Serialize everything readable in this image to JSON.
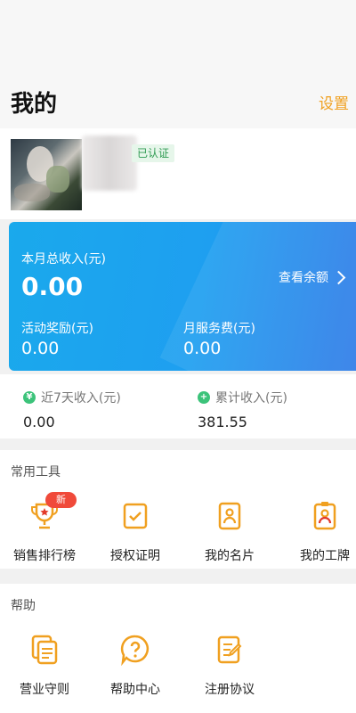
{
  "header": {
    "title": "我的",
    "settings_label": "设置"
  },
  "profile": {
    "verified_label": "已认证"
  },
  "income": {
    "month_total_label": "本月总收入(元)",
    "month_total_value": "0.00",
    "view_balance_label": "查看余额",
    "activity_reward_label": "活动奖励(元)",
    "activity_reward_value": "0.00",
    "monthly_fee_label": "月服务费(元)",
    "monthly_fee_value": "0.00"
  },
  "summary": {
    "last7_label": "近7天收入(元)",
    "last7_value": "0.00",
    "total_label": "累计收入(元)",
    "total_value": "381.55"
  },
  "tools": {
    "title": "常用工具",
    "new_badge": "新",
    "items": [
      {
        "label": "销售排行榜",
        "icon": "trophy-icon"
      },
      {
        "label": "授权证明",
        "icon": "certificate-icon"
      },
      {
        "label": "我的名片",
        "icon": "business-card-icon"
      },
      {
        "label": "我的工牌",
        "icon": "work-badge-icon"
      }
    ]
  },
  "help": {
    "title": "帮助",
    "items": [
      {
        "label": "营业守则",
        "icon": "documents-icon"
      },
      {
        "label": "帮助中心",
        "icon": "question-icon"
      },
      {
        "label": "注册协议",
        "icon": "agreement-icon"
      }
    ]
  },
  "colors": {
    "accent": "#f0a020",
    "card_start": "#1aa9ec",
    "card_end": "#2f7ce8",
    "badge": "#f04a3a",
    "verified_green": "#2f9b52"
  }
}
